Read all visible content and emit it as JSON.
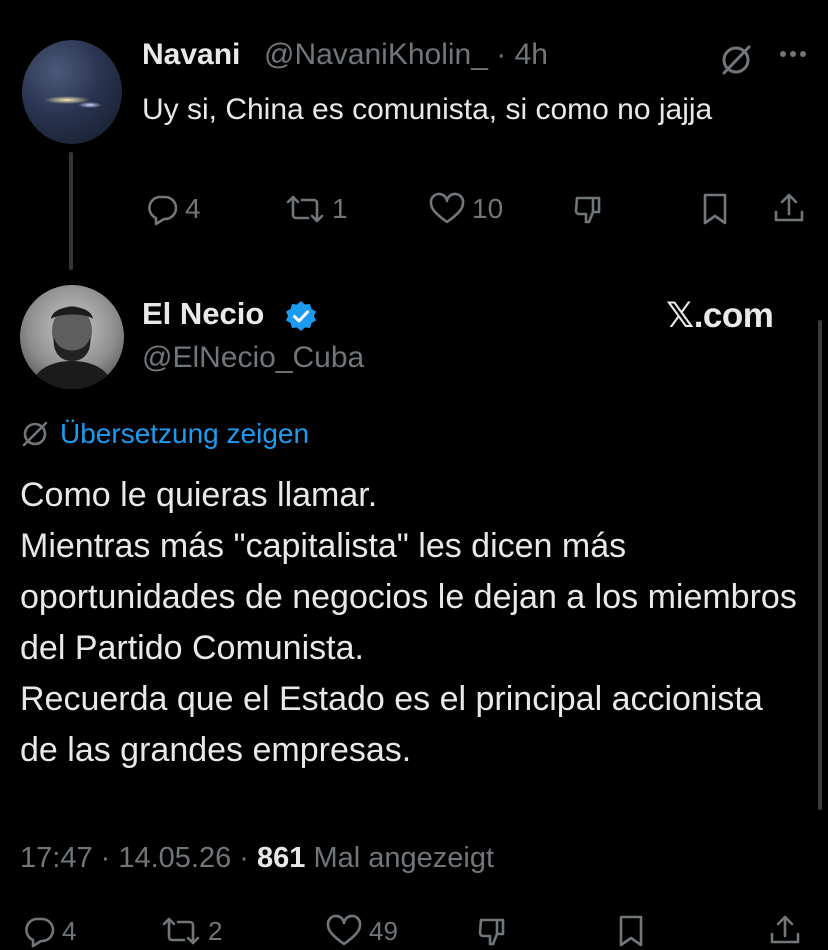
{
  "reply_tweet": {
    "author_name": "Navani",
    "author_handle_time": "@NavaniKholin_ · 4h",
    "text": "Uy si, China es comunista, si como no jajja",
    "icons": [
      "grok-icon",
      "more-icon"
    ],
    "actions": {
      "replies": "4",
      "reposts": "1",
      "likes": "10"
    }
  },
  "main_tweet": {
    "author_name": "El Necio",
    "author_handle": "@ElNecio_Cuba",
    "verified": true,
    "watermark": "𝕏.com",
    "translate_label": "Übersetzung zeigen",
    "text": "Como le quieras llamar.\nMientras más \"capitalista\" les dicen más oportunidades de negocios le dejan a los miembros del Partido Comunista.\nRecuerda que el Estado es el principal accionista de las grandes empresas.",
    "meta": {
      "time_date": "17:47 · 14.05.26 ·",
      "views_count": "861",
      "views_label": "Mal angezeigt"
    },
    "actions": {
      "replies": "4",
      "reposts": "2",
      "likes": "49"
    }
  },
  "colors": {
    "background": "#000000",
    "text": "#e7e9ea",
    "secondary": "#71767b",
    "accent": "#1d9bf0"
  }
}
